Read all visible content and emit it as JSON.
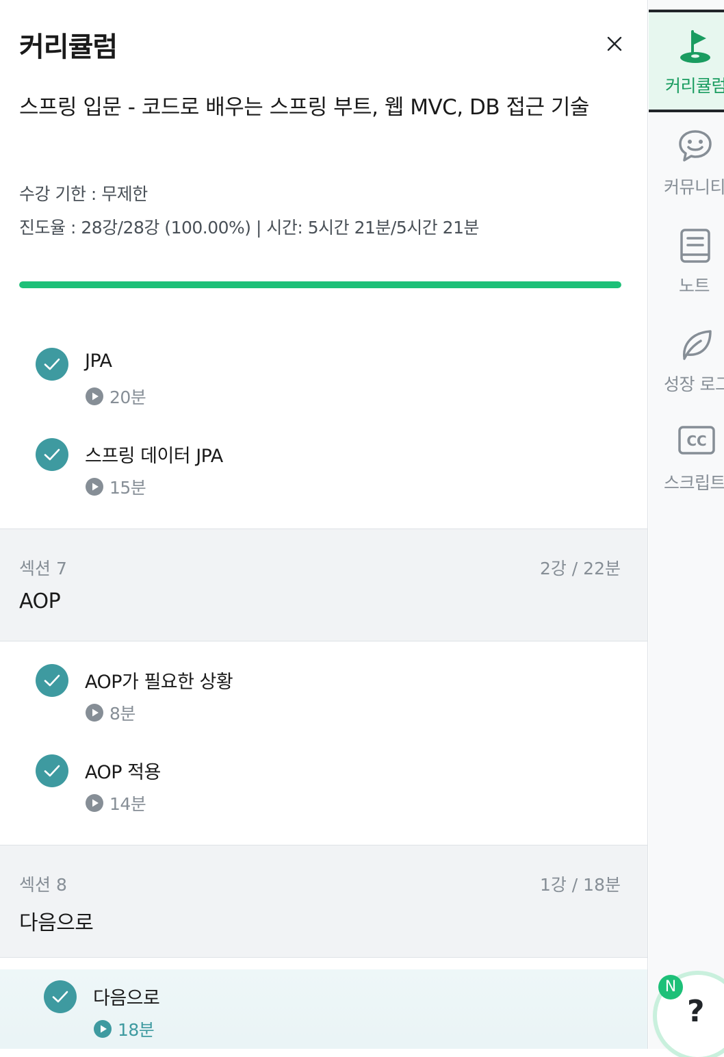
{
  "header": {
    "title": "커리큘럼",
    "close_icon": "close-icon"
  },
  "course": {
    "title": "스프링 입문 - 코드로 배우는 스프링 부트, 웹 MVC, DB 접근 기술",
    "period": "수강 기한 : 무제한",
    "progress_text": "진도율 : 28강/28강 (100.00%) | 시간: 5시간 21분/5시간 21분",
    "progress_fraction": 1.0
  },
  "lessons_before": [
    {
      "title": "JPA",
      "duration": "20분",
      "completed": true
    },
    {
      "title": "스프링 데이터 JPA",
      "duration": "15분",
      "completed": true
    }
  ],
  "sections": [
    {
      "number": "섹션 7",
      "count": "2강 / 22분",
      "name": "AOP",
      "lessons": [
        {
          "title": "AOP가 필요한 상황",
          "duration": "8분",
          "completed": true
        },
        {
          "title": "AOP 적용",
          "duration": "14분",
          "completed": true
        }
      ]
    },
    {
      "number": "섹션 8",
      "count": "1강 / 18분",
      "name": "다음으로",
      "lessons": [
        {
          "title": "다음으로",
          "duration": "18분",
          "completed": true,
          "current": true
        }
      ]
    }
  ],
  "rail": {
    "items": [
      {
        "label": "커리큘럼",
        "icon": "flag-icon",
        "active": true
      },
      {
        "label": "커뮤니티",
        "icon": "chat-smile-icon",
        "active": false
      },
      {
        "label": "노트",
        "icon": "note-book-icon",
        "active": false
      },
      {
        "label": "성장 로그",
        "icon": "leaf-icon",
        "active": false
      },
      {
        "label": "스크립트",
        "icon": "closed-caption-icon",
        "active": false
      }
    ]
  },
  "help": {
    "badge": "N",
    "label": "?"
  },
  "colors": {
    "accent": "#1dc078",
    "check": "#3e9aa0",
    "section_bg": "#f1f3f5"
  }
}
